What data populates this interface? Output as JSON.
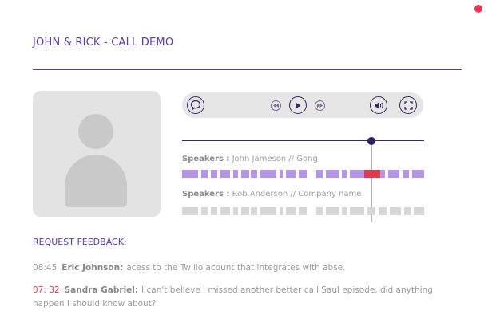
{
  "title": "JOHN & RICK - CALL DEMO",
  "colors": {
    "accent": "#5b3aa3",
    "dark": "#3b2463",
    "speaker1_track": "#b394e6",
    "speaker1_active": "#e23a4e",
    "speaker2_track": "#d6d6d6",
    "recording_dot": "#ee3355"
  },
  "controls": {
    "comment_icon": "speech-bubble-icon",
    "rewind_icon": "rewind-icon",
    "play_icon": "play-icon",
    "forward_icon": "fast-forward-icon",
    "volume_icon": "volume-icon",
    "fullscreen_icon": "fullscreen-icon"
  },
  "speakers": [
    {
      "label": "Speakers :",
      "name": " John Jameson // Gong"
    },
    {
      "label": "Speakers :",
      "name": " Rob Anderson // Company name"
    }
  ],
  "feedback": {
    "heading": "REQUEST FEEDBACK:",
    "comments": [
      {
        "time": "08:45",
        "author": "Eric Johnson:",
        "text": "acess to the Twilio acount that integrates with abse.",
        "active": false
      },
      {
        "time": "07: 32",
        "author": "Sandra Gabriel:",
        "text": "I can't believe i missed another better call Saul episode, did anything happen I should know about?",
        "active": true
      }
    ]
  }
}
